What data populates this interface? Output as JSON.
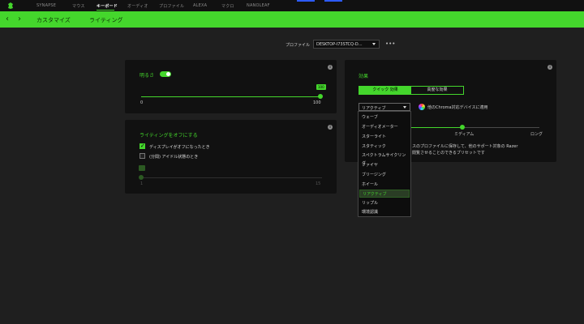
{
  "nav": {
    "items": [
      "SYNAPSE",
      "マウス",
      "キーボード",
      "オーディオ",
      "プロファイル",
      "ALEXA",
      "マクロ",
      "NANOLEAF"
    ],
    "active_index": 2
  },
  "subnav": {
    "back_icon": "chevron-left-icon",
    "forward_icon": "chevron-right-icon",
    "tabs": [
      "カスタマイズ",
      "ライティング"
    ]
  },
  "profile": {
    "label": "プロファイル",
    "value": "DESKTOP-I73STCQ-D...",
    "more_label": "•••"
  },
  "brightness_panel": {
    "title": "明るさ",
    "enabled": true,
    "value_badge": "100",
    "level": 1.0,
    "min_label": "0",
    "max_label": "100"
  },
  "lighting_off_panel": {
    "title": "ライティングをオフにする",
    "options": [
      {
        "label": "ディスプレイがオフになったとき",
        "checked": true
      },
      {
        "label": "(分間) アイドル状態のとき",
        "checked": false
      }
    ],
    "min_label": "1",
    "max_label": "15"
  },
  "effects_panel": {
    "title": "効果",
    "tabs": [
      "クイック 効果",
      "高度な効果"
    ],
    "active_tab": 0,
    "selected_effect": "リアクティブ",
    "chroma_text": "他のChroma対応デバイスに適用",
    "speed_labels": [
      "ミディアム",
      "ロング"
    ],
    "description_lines": [
      "スのプロファイルに保存して、他のサポート対象の Razer",
      "閲覧させることのできるプリセットです"
    ]
  },
  "effects_dropdown": {
    "items": [
      "ウェーブ",
      "オーディオメーター",
      "スターライト",
      "スタティック",
      "スペクトラムサイクリング",
      "ファイヤ",
      "ブリージング",
      "ホイール",
      "リアクティブ",
      "リップル",
      "環境認識"
    ],
    "selected_index": 8
  },
  "colors": {
    "accent": "#44d62c",
    "panel": "#111111",
    "background": "#1f1f1f"
  }
}
